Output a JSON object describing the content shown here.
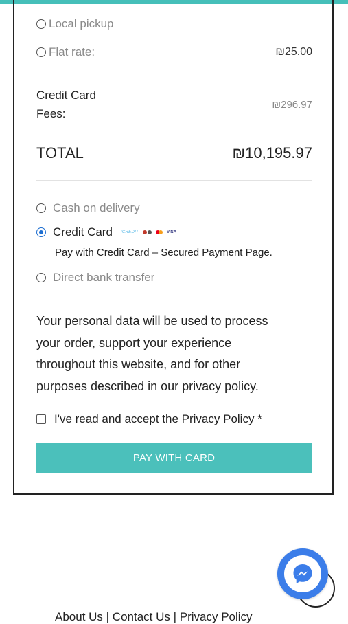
{
  "colors": {
    "accent": "#45bfb9",
    "button": "#4bc0bb",
    "radio_selected": "#1f6fd1",
    "messenger": "#3b7de9"
  },
  "shipping": {
    "local_pickup_label": "Local pickup",
    "flat_rate_label": "Flat rate:",
    "flat_rate_price": "₪25.00"
  },
  "fees": {
    "label_line1": "Credit Card",
    "label_line2": "Fees:",
    "value": "₪296.97"
  },
  "total": {
    "label": "TOTAL",
    "value": "₪10,195.97"
  },
  "payment": {
    "cash_on_delivery": "Cash on delivery",
    "credit_card": "Credit Card",
    "credit_card_desc": "Pay with Credit Card – Secured Payment Page.",
    "direct_bank_transfer": "Direct bank transfer",
    "logos": {
      "icardit": "ICREDIT",
      "visa": "VISA"
    }
  },
  "privacy": {
    "text": "Your personal data will be used to process your order, support your experience throughout this website, and for other purposes described in our privacy policy.",
    "accept_label": "I've read and accept the Privacy Policy *"
  },
  "pay_button_label": "PAY WITH CARD",
  "footer": {
    "links_text": "About Us | Contact Us | Privacy Policy"
  },
  "icons": [
    "radio-icon",
    "checkbox-icon",
    "messenger-icon"
  ]
}
